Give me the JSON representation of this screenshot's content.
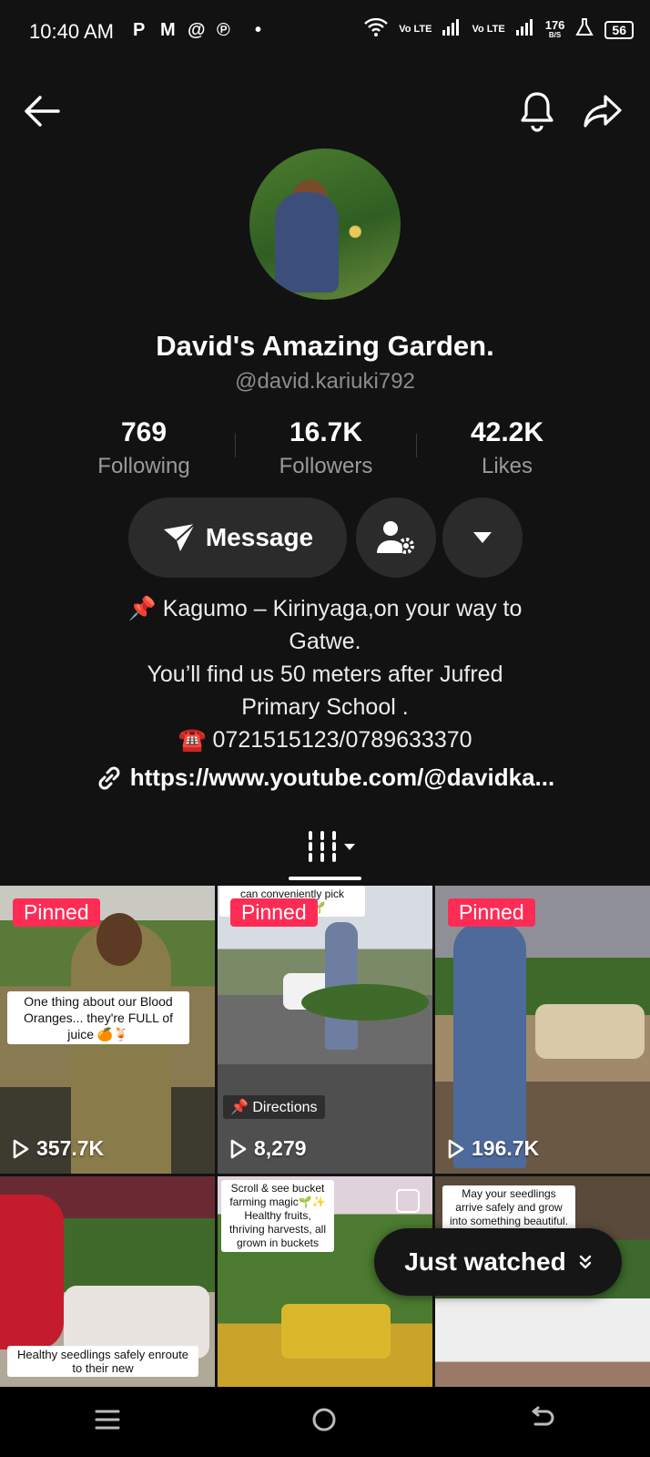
{
  "status_bar": {
    "time": "10:40 AM",
    "app_icons": [
      "p-icon",
      "gmail-icon",
      "threads-icon",
      "pinterest-icon",
      "dot-icon"
    ],
    "network_label_1": "Vo LTE",
    "network_label_2": "Vo LTE",
    "speed": "176",
    "speed_unit": "B/S",
    "battery": "56"
  },
  "header": {
    "back_icon": "arrow-left-icon",
    "bell_icon": "bell-icon",
    "share_icon": "share-icon"
  },
  "profile": {
    "name": "David's Amazing Garden.",
    "handle": "@david.kariuki792",
    "stats": [
      {
        "value": "769",
        "label": "Following"
      },
      {
        "value": "16.7K",
        "label": "Followers"
      },
      {
        "value": "42.2K",
        "label": "Likes"
      }
    ],
    "message_label": "Message",
    "bio_lines": [
      "📌 Kagumo – Kirinyaga,on your way to",
      "Gatwe.",
      "You’ll find us 50 meters after Jufred",
      "Primary School .",
      "☎️ 0721515123/0789633370"
    ],
    "link": "https://www.youtube.com/@davidka..."
  },
  "videos": [
    {
      "pinned_label": "Pinned",
      "views": "357.7K",
      "caption": "One thing about our Blood Oranges... they're FULL of juice 🍊🍹"
    },
    {
      "pinned_label": "Pinned",
      "views": "8,279",
      "caption_top": "can conveniently pick",
      "caption_top2": "y… …ings 🌱",
      "directions": "📌 Directions"
    },
    {
      "pinned_label": "Pinned",
      "views": "196.7K"
    },
    {
      "caption": "Healthy seedlings safely enroute to their new"
    },
    {
      "caption": "Scroll & see bucket farming magic🌱✨ Healthy fruits, thriving harvests, all grown in buckets"
    },
    {
      "caption": "May your seedlings arrive safely and grow into something beautiful. 💚"
    }
  ],
  "just_watched": {
    "label": "Just watched"
  },
  "colors": {
    "accent": "#fe2c55",
    "background": "#121212",
    "pill": "#2b2b2b"
  }
}
